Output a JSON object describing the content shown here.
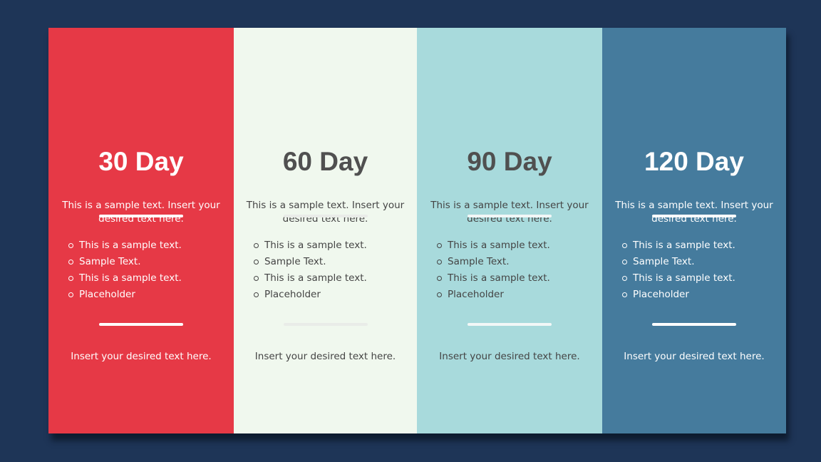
{
  "colors": {
    "background": "#1e3557"
  },
  "columns": [
    {
      "title": "30 Day",
      "bg": "#e63946",
      "title_color": "#ffffff",
      "text_color": "#ffffff",
      "rule_color": "#ffffff",
      "desc": "This is a sample text. Insert your desired text here.",
      "bullets": [
        "This is a sample text.",
        "Sample Text.",
        "This is a sample text.",
        "Placeholder"
      ],
      "footer": "Insert your desired text here.",
      "bullet_icon": "hollow-circle"
    },
    {
      "title": "60 Day",
      "bg": "#f0f8ee",
      "title_color": "#505050",
      "text_color": "#444444",
      "rule_color": "#e9ece8",
      "desc": "This is a sample text. Insert your desired text here.",
      "bullets": [
        "This is a sample text.",
        "Sample Text.",
        "This is a sample text.",
        "Placeholder"
      ],
      "footer": "Insert your desired text here.",
      "bullet_icon": "hollow-circle"
    },
    {
      "title": "90 Day",
      "bg": "#a8dadc",
      "title_color": "#505050",
      "text_color": "#444444",
      "rule_color": "#f2f7f7",
      "desc": "This is a sample text. Insert your desired text here.",
      "bullets": [
        "This is a sample text.",
        "Sample Text.",
        "This is a sample text.",
        "Placeholder"
      ],
      "footer": "Insert your desired text here.",
      "bullet_icon": "hollow-circle"
    },
    {
      "title": "120 Day",
      "bg": "#457b9d",
      "title_color": "#ffffff",
      "text_color": "#ffffff",
      "rule_color": "#ffffff",
      "desc": "This is a sample text. Insert your desired text here.",
      "bullets": [
        "This is a sample text.",
        "Sample Text.",
        "This is a sample text.",
        "Placeholder"
      ],
      "footer": "Insert your desired text here.",
      "bullet_icon": "hollow-circle"
    }
  ]
}
